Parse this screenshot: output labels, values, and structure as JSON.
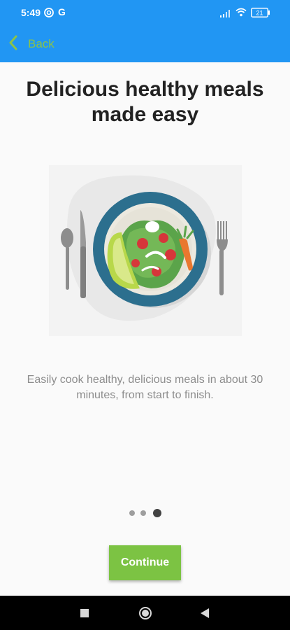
{
  "status_bar": {
    "time": "5:49",
    "app_icon": "G",
    "battery": "21",
    "icons": [
      "at-sign-icon",
      "signal-icon",
      "wifi-icon",
      "battery-icon"
    ]
  },
  "app_bar": {
    "back_label": "Back",
    "back_icon": "chevron-left-icon",
    "background_color": "#2196f3",
    "accent_color": "#8bc34a"
  },
  "onboarding": {
    "title": "Delicious healthy meals made easy",
    "illustration": "salad-plate-illustration",
    "description": "Easily cook healthy, delicious meals in about 30 minutes, from start to finish.",
    "page_indicator": {
      "total": 3,
      "current": 3
    },
    "continue_label": "Continue",
    "continue_color": "#7cc343"
  },
  "nav_bar": {
    "items": [
      "recents-square-icon",
      "home-circle-icon",
      "back-triangle-icon"
    ]
  }
}
